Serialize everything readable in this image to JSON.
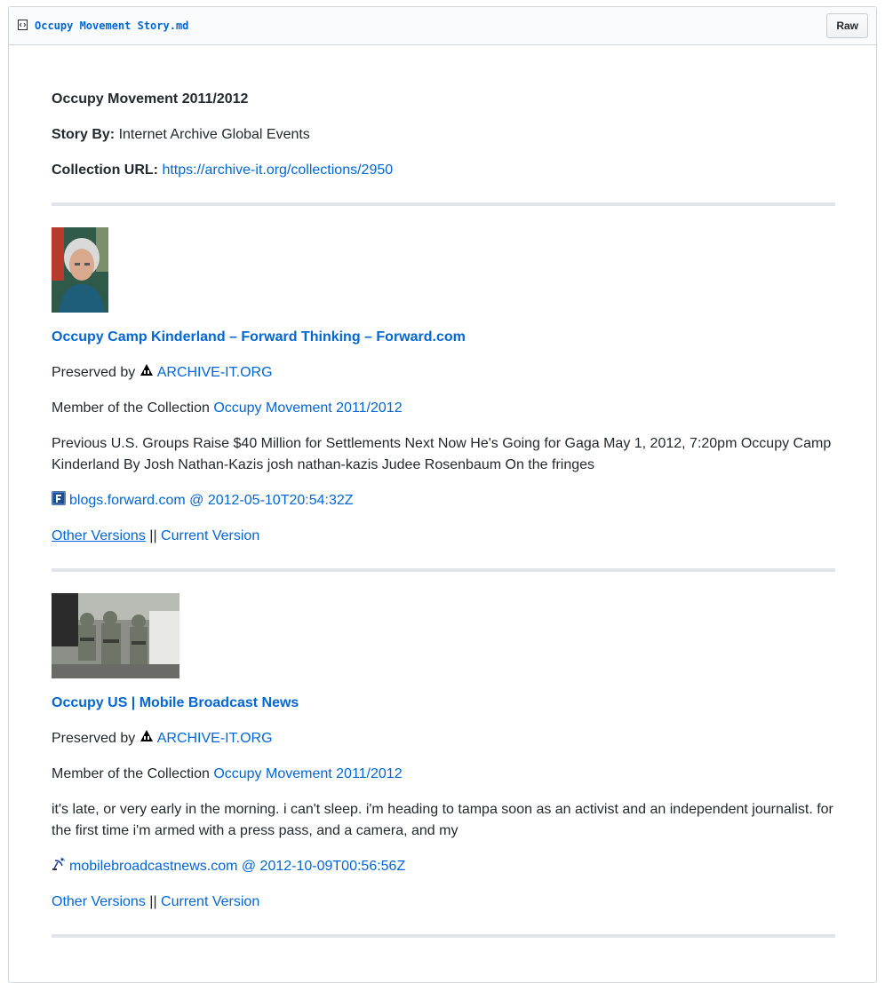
{
  "file": {
    "name": "Occupy Movement Story.md",
    "raw_label": "Raw"
  },
  "story": {
    "title": "Occupy Movement 2011/2012",
    "story_by_label": "Story By:",
    "story_by_value": "Internet Archive Global Events",
    "collection_url_label": "Collection URL:",
    "collection_url": "https://archive-it.org/collections/2950"
  },
  "entries": [
    {
      "title": "Occupy Camp Kinderland – Forward Thinking – Forward.com",
      "preserved_by_label": "Preserved by",
      "preserved_by_link": "ARCHIVE-IT.ORG",
      "member_label": "Member of the Collection",
      "member_link": "Occupy Movement 2011/2012",
      "snippet": "Previous U.S. Groups Raise $40 Million for Settlements Next Now He's Going for Gaga May 1, 2012, 7:20pm Occupy Camp Kinderland By Josh Nathan-Kazis josh nathan-kazis Judee Rosenbaum On the fringes",
      "source_link": "blogs.forward.com @ 2012-05-10T20:54:32Z",
      "other_versions": "Other Versions",
      "separator": "||",
      "current_version": "Current Version",
      "favicon": "forward-f-favicon"
    },
    {
      "title": "Occupy US | Mobile Broadcast News",
      "preserved_by_label": "Preserved by",
      "preserved_by_link": "ARCHIVE-IT.ORG",
      "member_label": "Member of the Collection",
      "member_link": "Occupy Movement 2011/2012",
      "snippet": "it's late, or very early in the morning. i can't sleep. i'm heading to tampa soon as an activist and an independent journalist. for the first time i'm armed with a press pass, and a camera, and my",
      "source_link": "mobilebroadcastnews.com @ 2012-10-09T00:56:56Z",
      "other_versions": "Other Versions",
      "separator": "||",
      "current_version": "Current Version",
      "favicon": "satellite-dish-favicon"
    }
  ],
  "colors": {
    "link": "#0366d6",
    "text": "#24292e",
    "rule": "#e1e4e8",
    "border": "#d1d5da"
  }
}
